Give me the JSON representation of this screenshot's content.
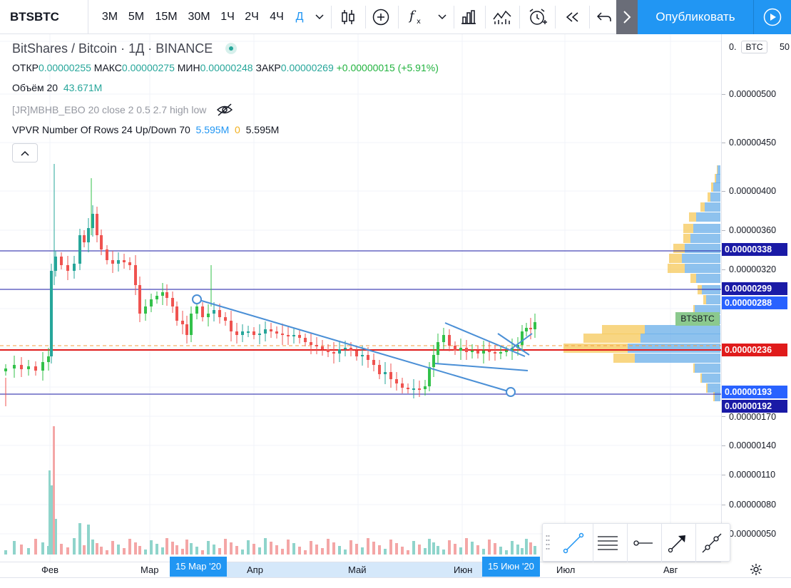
{
  "toolbar": {
    "symbol": "BTSBTC",
    "intervals": [
      "3M",
      "5M",
      "15M",
      "30M",
      "1Ч",
      "2Ч",
      "4Ч",
      "Д"
    ],
    "active_interval": "Д",
    "icons": [
      "chevron-down-icon",
      "candles-icon",
      "add-compare-icon",
      "function-icon",
      "chevron-down-icon",
      "bar-chart-icon",
      "indicator-templates-icon",
      "alarm-add-icon",
      "replay-icon",
      "undo-icon",
      "chevron-right-icon",
      "play-icon"
    ],
    "publish_label": "Опубликовать"
  },
  "legend": {
    "title": "BitShares / Bitcoin · 1Д · BINANCE",
    "ohlc": {
      "open_label": "ОТКР",
      "open": "0.00000255",
      "high_label": "МАКС",
      "high": "0.00000275",
      "low_label": "МИН",
      "low": "0.00000248",
      "close_label": "ЗАКР",
      "close": "0.00000269",
      "change": "+0.00000015 (+5.91%)"
    },
    "volume": {
      "label": "Объём 20",
      "value": "43.671M"
    },
    "indicator1": {
      "label": "[JR]MBHB_EBO 20 close 2 0.5 2.7 high low"
    },
    "indicator2": {
      "label": "VPVR Number Of Rows 24 Up/Down 70",
      "v1": "5.595M",
      "v2": "0",
      "v3": "5.595M"
    }
  },
  "price_scale": {
    "currency": "BTC",
    "top_partial": "0.",
    "top_partial_tail": "50",
    "ticks": [
      "0.00000500",
      "0.00000450",
      "0.00000400",
      "0.00000360",
      "0.00000320",
      "0.00000170",
      "0.00000140",
      "0.00000110",
      "0.00000080",
      "0.00000050"
    ],
    "badges": [
      {
        "value": "0.00000338",
        "style": "navy"
      },
      {
        "value": "0.00000299",
        "style": "navy"
      },
      {
        "value": "0.00000288",
        "style": "blue"
      },
      {
        "value": "0.00000236",
        "style": "red"
      },
      {
        "value": "0.00000193",
        "style": "blue"
      },
      {
        "value": "0.00000192",
        "style": "navy"
      }
    ],
    "symbol_tag": "BTSBTC"
  },
  "time_axis": {
    "labels": [
      "Фев",
      "Мар",
      "Апр",
      "Май",
      "Июн",
      "Июл",
      "Авг"
    ],
    "highlight_start": "15 Мар '20",
    "highlight_end": "15 Июн '20"
  },
  "chart_data": {
    "type": "candlestick",
    "symbol": "BTSBTC",
    "interval": "1D",
    "exchange": "BINANCE",
    "last_close": 2.69e-06,
    "horizontal_levels": [
      3.38e-06,
      2.99e-06,
      2.36e-06,
      1.92e-06
    ],
    "colors": {
      "up": "#26a69a",
      "down": "#ef5350",
      "bright_up": "#33c14a",
      "level": "#1a1aa6",
      "trendline": "#4a8fd6"
    }
  },
  "drawing_toolbar": {
    "tools": [
      "trend-line-icon",
      "horizontal-lines-icon",
      "horizontal-ray-icon",
      "arrow-icon",
      "extended-line-icon"
    ]
  }
}
